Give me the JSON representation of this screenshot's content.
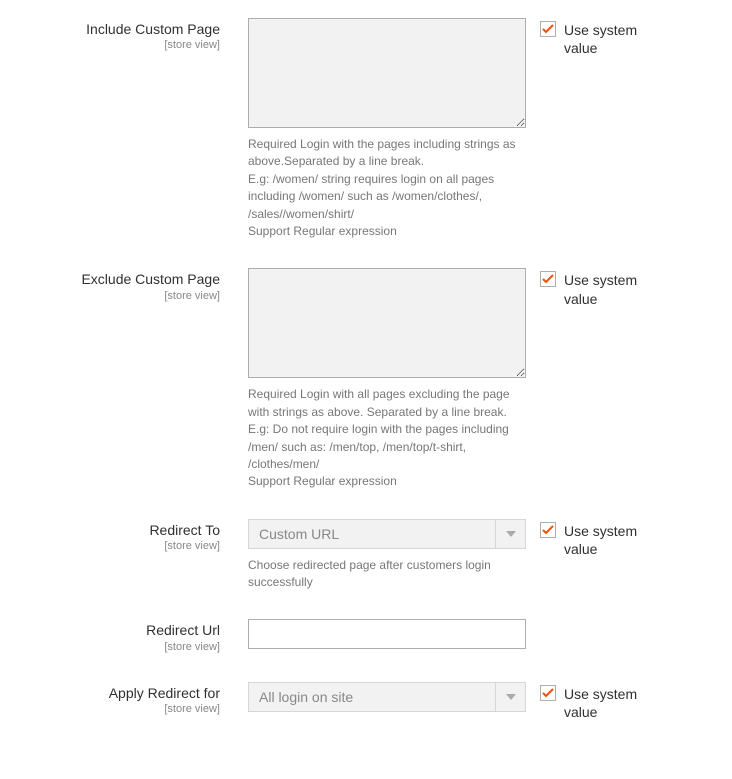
{
  "scope_label": "[store view]",
  "use_system_value_label": "Use system value",
  "fields": {
    "include_custom_page": {
      "label": "Include Custom Page",
      "help": "Required Login with the pages including strings as above.Separated by a line break.\nE.g: /women/ string requires login on all pages including /women/ such as /women/clothes/, /sales//women/shirt/\nSupport Regular expression"
    },
    "exclude_custom_page": {
      "label": "Exclude Custom Page",
      "help": "Required Login with all pages excluding the page with strings as above. Separated by a line break. E.g: Do not require login with the pages including /men/ such as: /men/top, /men/top/t-shirt, /clothes/men/\nSupport Regular expression"
    },
    "redirect_to": {
      "label": "Redirect To",
      "value": "Custom URL",
      "help": "Choose redirected page after customers login successfully"
    },
    "redirect_url": {
      "label": "Redirect Url",
      "value": ""
    },
    "apply_redirect_for": {
      "label": "Apply Redirect for",
      "value": "All login on site"
    }
  }
}
